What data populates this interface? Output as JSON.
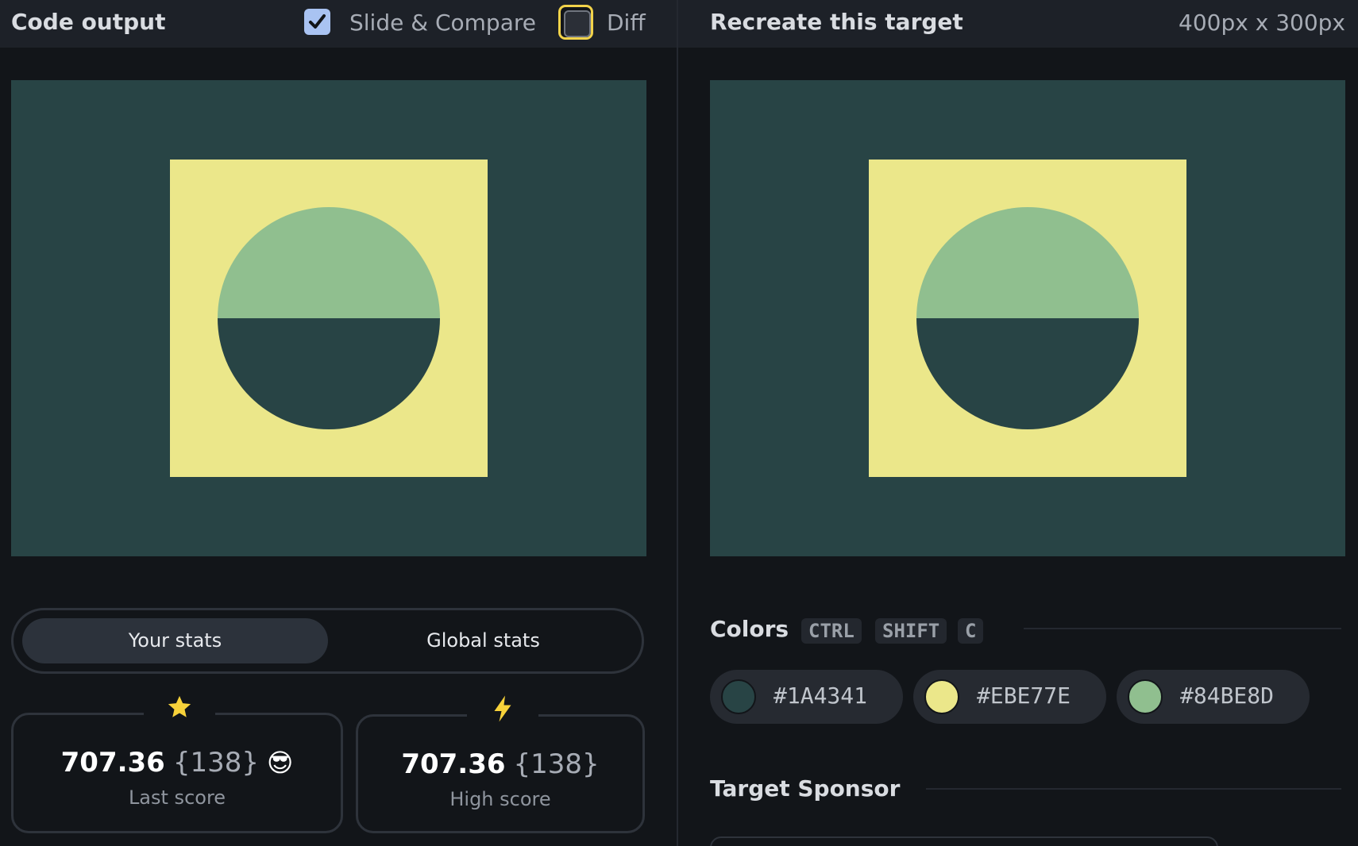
{
  "left_panel": {
    "title": "Code output",
    "slide_compare": {
      "label": "Slide & Compare",
      "checked": true
    },
    "diff": {
      "label": "Diff",
      "checked": false
    }
  },
  "right_panel": {
    "title": "Recreate this target",
    "dimensions": "400px x 300px"
  },
  "canvas_colors": {
    "background": "#284445",
    "square": "#EBE78A",
    "circle_top": "#90BF8F",
    "circle_bottom": "#284445"
  },
  "stats_toggle": {
    "your_stats": "Your stats",
    "global_stats": "Global stats",
    "active": "your_stats"
  },
  "last_score": {
    "icon": "star-icon",
    "score": "707.36",
    "count": "{138}",
    "emoji": "😎",
    "label": "Last score"
  },
  "high_score": {
    "icon": "lightning-icon",
    "score": "707.36",
    "count": "{138}",
    "label": "High score"
  },
  "colors": {
    "title": "Colors",
    "shortcut": [
      "CTRL",
      "SHIFT",
      "C"
    ],
    "swatches": [
      {
        "hex": "#1A4341",
        "color": "#284445"
      },
      {
        "hex": "#EBE77E",
        "color": "#EBE78A"
      },
      {
        "hex": "#84BE8D",
        "color": "#90BF8F"
      }
    ]
  },
  "sponsor": {
    "title": "Target Sponsor"
  }
}
